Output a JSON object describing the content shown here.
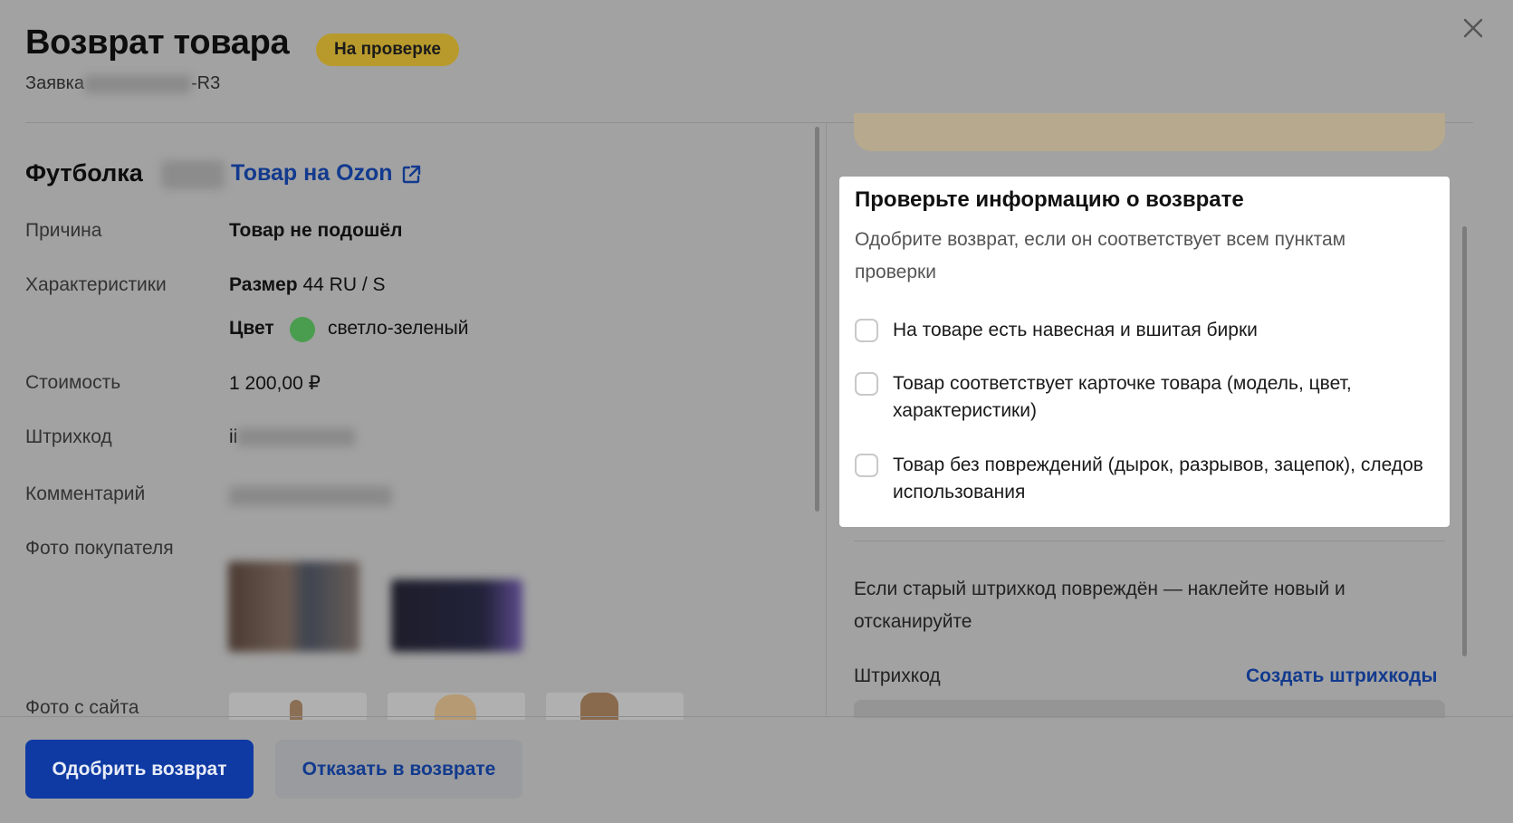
{
  "modal": {
    "title": "Возврат товара",
    "status_badge": "На проверке",
    "request_prefix": "Заявка",
    "request_suffix": "-R3"
  },
  "product": {
    "name": "Футболка",
    "ozon_link": "Товар на Ozon"
  },
  "details": {
    "reason_label": "Причина",
    "reason_value": "Товар не подошёл",
    "characteristics_label": "Характеристики",
    "size_key": "Размер",
    "size_value": "44 RU / S",
    "color_key": "Цвет",
    "color_value": "светло-зеленый",
    "color_swatch": "#4a9d4f",
    "price_label": "Стоимость",
    "price_value": "1 200,00 ₽",
    "barcode_label": "Штрихкод",
    "barcode_prefix": "ii",
    "comment_label": "Комментарий",
    "buyer_photo_label": "Фото покупателя",
    "site_photo_label": "Фото с сайта"
  },
  "checklist": {
    "title": "Проверьте информацию о возврате",
    "description": "Одобрите возврат, если он соответствует всем пунктам проверки",
    "items": [
      {
        "label": "На товаре есть навесная и вшитая бирки",
        "checked": false
      },
      {
        "label": "Товар соответствует карточке товара (модель, цвет, характеристики)",
        "checked": false
      },
      {
        "label": "Товар без повреждений (дырок, разрывов, зацепок), следов использования",
        "checked": false
      }
    ]
  },
  "barcode_section": {
    "notice": "Если старый штрихкод повреждён — наклейте новый и отсканируйте",
    "label": "Штрихкод",
    "create_link": "Создать штрихкоды"
  },
  "footer": {
    "approve_button": "Одобрить возврат",
    "reject_button": "Отказать в возврате"
  },
  "colors": {
    "accent": "#123a8e",
    "badge": "#b89a2c"
  }
}
